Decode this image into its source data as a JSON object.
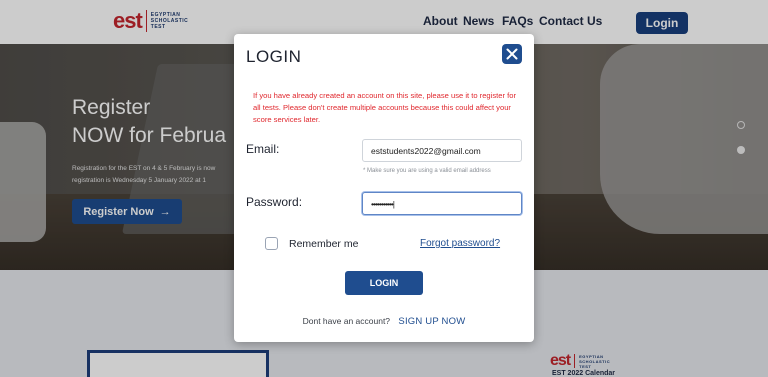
{
  "header": {
    "logo_mark": "est",
    "logo_lines": [
      "EGYPTIAN",
      "SCHOLASTIC",
      "TEST"
    ],
    "nav": [
      {
        "label": "About"
      },
      {
        "label": "News"
      },
      {
        "label": "FAQs"
      },
      {
        "label": "Contact Us"
      }
    ],
    "login_label": "Login"
  },
  "hero": {
    "title_line1": "Register",
    "title_line2": "NOW for Februa",
    "sub_line1": "Registration for the EST on 4 & 5 February is now",
    "sub_line2": "registration is Wednesday 5 January 2022 at 1",
    "cta_label": "Register Now",
    "cta_arrow": "→"
  },
  "below": {
    "logo_mark": "est",
    "logo_lines": [
      "EGYPTIAN",
      "SCHOLASTIC",
      "TEST"
    ],
    "calendar_label": "EST 2022 Calendar"
  },
  "modal": {
    "title": "LOGIN",
    "close_icon": "close-icon",
    "warning": "If you have already created an account on this site, please use it to register for all tests. Please don't create multiple accounts because this could affect your score services later.",
    "email_label": "Email:",
    "email_value": "eststudents2022@gmail.com",
    "email_hint": "* Make sure you are using a valid email address",
    "password_label": "Password:",
    "password_value": "•••••••••••|",
    "remember_label": "Remember me",
    "forgot_label": "Forgot password?",
    "submit_label": "LOGIN",
    "signup_prompt": "Dont have an account?",
    "signup_link": "SIGN UP NOW"
  },
  "colors": {
    "brand_blue": "#1f4d8f",
    "brand_red": "#c4262e",
    "warning_red": "#e0282e"
  }
}
